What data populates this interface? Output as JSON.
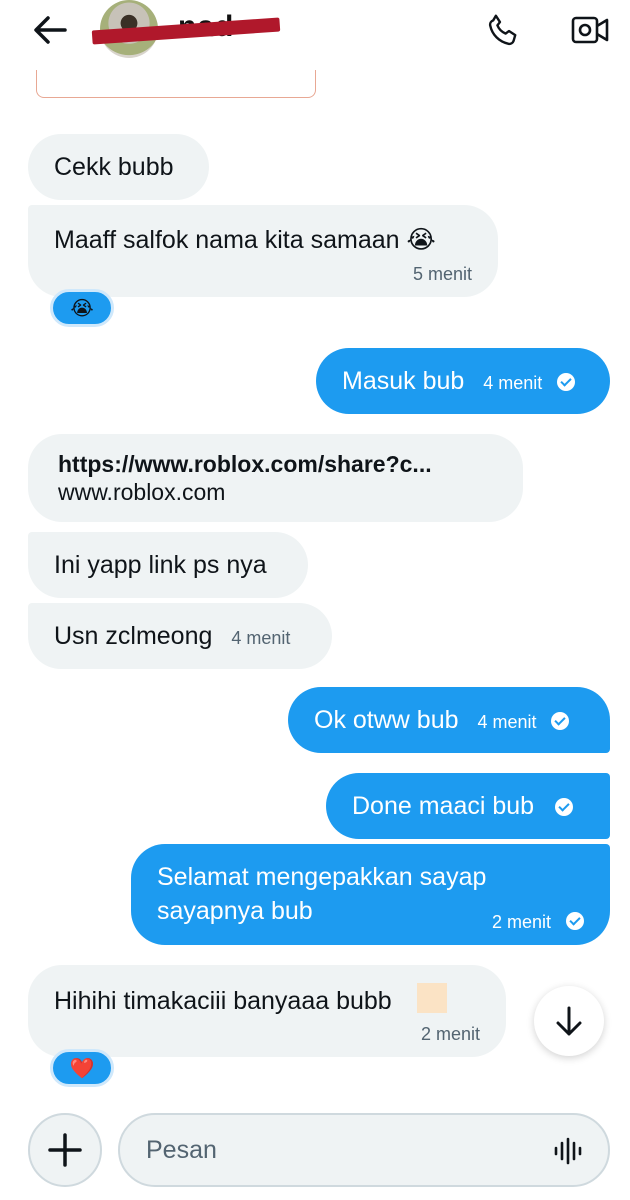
{
  "header": {
    "contact_name": "nad",
    "icons": {
      "back": "arrow-left-icon",
      "call": "phone-icon",
      "video": "video-camera-icon"
    }
  },
  "messages": [
    {
      "direction": "incoming",
      "text": "Cekk bubb",
      "time": ""
    },
    {
      "direction": "incoming",
      "text": "Maaff salfok nama kita samaan 😭",
      "time": "5 menit",
      "reaction": "😭"
    },
    {
      "direction": "outgoing",
      "text": "Masuk bub",
      "time": "4 menit",
      "read": true
    },
    {
      "direction": "incoming",
      "link_url": "https://www.roblox.com/share?c...",
      "link_domain": "www.roblox.com"
    },
    {
      "direction": "incoming",
      "text": "Ini yapp link ps nya",
      "time": ""
    },
    {
      "direction": "incoming",
      "text": "Usn zclmeong",
      "time": "4 menit"
    },
    {
      "direction": "outgoing",
      "text": "Ok otww bub",
      "time": "4 menit",
      "read": true
    },
    {
      "direction": "outgoing",
      "text": "Done maaci bub",
      "time": "",
      "read": true
    },
    {
      "direction": "outgoing",
      "text_line1": "Selamat mengepakkan sayap",
      "text_line2": "sayapnya bub",
      "time": "2 menit",
      "read": true
    },
    {
      "direction": "incoming",
      "text": "Hihihi timakaciii banyaaa bubb",
      "time": "2 menit",
      "reaction": "❤️"
    }
  ],
  "composer": {
    "placeholder": "Pesan",
    "icons": {
      "add": "plus-icon",
      "voice": "voice-wave-icon",
      "scroll": "arrow-down-icon"
    }
  },
  "colors": {
    "accent": "#1d9bf0",
    "incoming_bg": "#eff3f4",
    "text": "#0f1419",
    "muted": "#536471",
    "redaction": "#b0182b"
  }
}
